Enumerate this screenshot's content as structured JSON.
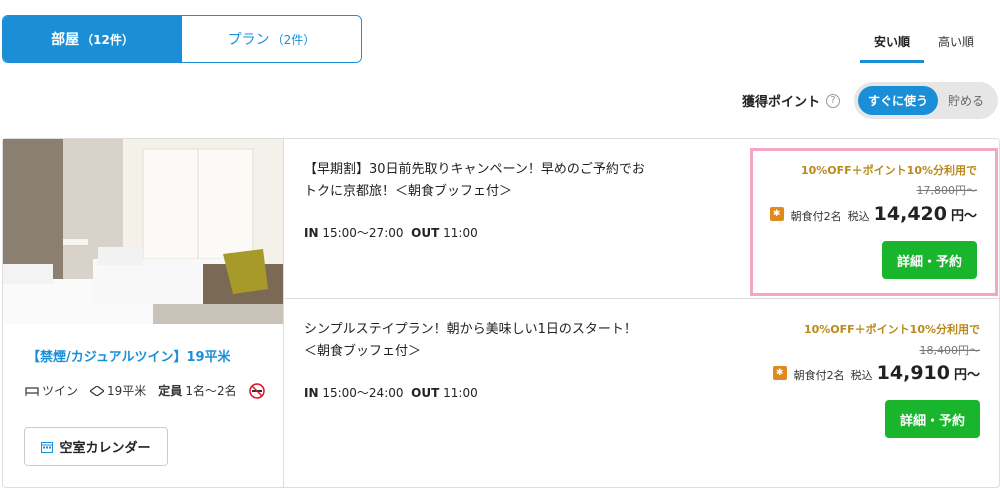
{
  "tabs": {
    "rooms_label": "部屋",
    "rooms_count": "（12件）",
    "plans_label": "プラン",
    "plans_count": "（2件）"
  },
  "sort": {
    "cheap": "安い順",
    "expensive": "高い順"
  },
  "points": {
    "label": "獲得ポイント",
    "help": "?",
    "use_now": "すぐに使う",
    "save": "貯める"
  },
  "room": {
    "name": "【禁煙/カジュアルツイン】19平米",
    "bed": "ツイン",
    "size": "19平米",
    "capacity_label": "定員",
    "capacity": "1名～2名",
    "calendar_button": "空室カレンダー"
  },
  "plans": [
    {
      "title": "【早期割】30日前先取りキャンペーン！早めのご予約でおトクに京都旅！＜朝食ブッフェ付＞",
      "in_label": "IN",
      "in_time": "15:00～27:00",
      "out_label": "OUT",
      "out_time": "11:00",
      "discount": "10%OFF＋ポイント10%分利用で",
      "original_price": "17,800円～",
      "meal": "朝食付2名",
      "tax": "税込",
      "price": "14,420",
      "price_suffix": "円～",
      "button": "詳細・予約"
    },
    {
      "title": "シンプルステイプラン！朝から美味しい1日のスタート！＜朝食ブッフェ付＞",
      "in_label": "IN",
      "in_time": "15:00～24:00",
      "out_label": "OUT",
      "out_time": "11:00",
      "discount": "10%OFF＋ポイント10%分利用で",
      "original_price": "18,400円～",
      "meal": "朝食付2名",
      "tax": "税込",
      "price": "14,910",
      "price_suffix": "円～",
      "button": "詳細・予約"
    }
  ],
  "colors": {
    "accent": "#1a8fd8",
    "book": "#18b52d",
    "discount": "#b98a1a",
    "highlight": "#f2a7c6"
  }
}
